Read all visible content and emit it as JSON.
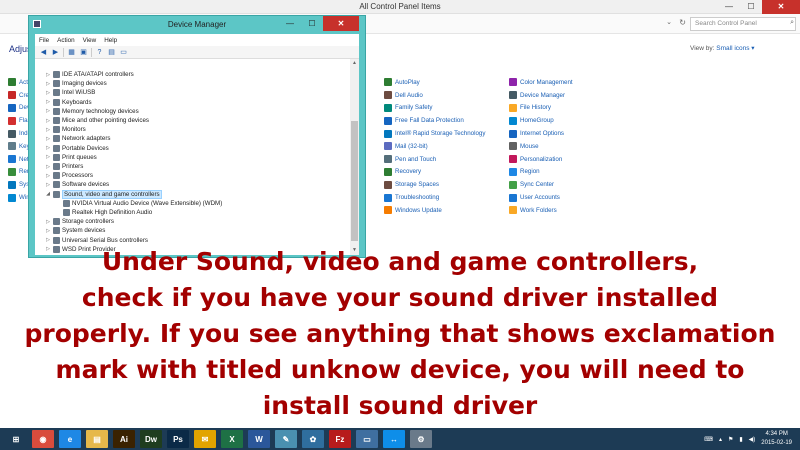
{
  "control_panel": {
    "title": "All Control Panel Items",
    "search_placeholder": "Search Control Panel",
    "adjust_heading": "Adjus",
    "view_by_label": "View by:",
    "view_by_value": "Small icons ▾",
    "left_stub": [
      {
        "label": "Acti",
        "color": "#2e7d32"
      },
      {
        "label": "Cre",
        "color": "#c62828"
      },
      {
        "label": "Dev",
        "color": "#1565c0"
      },
      {
        "label": "Flas",
        "color": "#d32f2f"
      },
      {
        "label": "Inde",
        "color": "#455a64"
      },
      {
        "label": "Key",
        "color": "#607d8b"
      },
      {
        "label": "Net",
        "color": "#1976d2"
      },
      {
        "label": "Ren",
        "color": "#388e3c"
      },
      {
        "label": "Syst",
        "color": "#0277bd"
      },
      {
        "label": "Win",
        "color": "#0288d1"
      }
    ],
    "col2": [
      {
        "label": "AutoPlay",
        "color": "#2e7d32"
      },
      {
        "label": "Dell Audio",
        "color": "#6d4c41"
      },
      {
        "label": "Family Safety",
        "color": "#00897b"
      },
      {
        "label": "Free Fall Data Protection",
        "color": "#1565c0"
      },
      {
        "label": "Intel® Rapid Storage Technology",
        "color": "#0277bd"
      },
      {
        "label": "Mail (32-bit)",
        "color": "#5c6bc0"
      },
      {
        "label": "Pen and Touch",
        "color": "#546e7a"
      },
      {
        "label": "Recovery",
        "color": "#2e7d32"
      },
      {
        "label": "Storage Spaces",
        "color": "#6d4c41"
      },
      {
        "label": "Troubleshooting",
        "color": "#1976d2"
      },
      {
        "label": "Windows Update",
        "color": "#f57c00"
      }
    ],
    "col3": [
      {
        "label": "Color Management",
        "color": "#8e24aa"
      },
      {
        "label": "Device Manager",
        "color": "#455a64"
      },
      {
        "label": "File History",
        "color": "#f9a825"
      },
      {
        "label": "HomeGroup",
        "color": "#0288d1"
      },
      {
        "label": "Internet Options",
        "color": "#1565c0"
      },
      {
        "label": "Mouse",
        "color": "#616161"
      },
      {
        "label": "Personalization",
        "color": "#c2185b"
      },
      {
        "label": "Region",
        "color": "#1e88e5"
      },
      {
        "label": "Sync Center",
        "color": "#43a047"
      },
      {
        "label": "User Accounts",
        "color": "#1976d2"
      },
      {
        "label": "Work Folders",
        "color": "#f9a825"
      }
    ]
  },
  "device_manager": {
    "title": "Device Manager",
    "menu": [
      "File",
      "Action",
      "View",
      "Help"
    ],
    "tree": [
      {
        "label": "IDE ATA/ATAPI controllers",
        "level": 1,
        "arrow": "▷"
      },
      {
        "label": "Imaging devices",
        "level": 1,
        "arrow": "▷"
      },
      {
        "label": "Intel WiUSB",
        "level": 1,
        "arrow": "▷"
      },
      {
        "label": "Keyboards",
        "level": 1,
        "arrow": "▷"
      },
      {
        "label": "Memory technology devices",
        "level": 1,
        "arrow": "▷"
      },
      {
        "label": "Mice and other pointing devices",
        "level": 1,
        "arrow": "▷"
      },
      {
        "label": "Monitors",
        "level": 1,
        "arrow": "▷"
      },
      {
        "label": "Network adapters",
        "level": 1,
        "arrow": "▷"
      },
      {
        "label": "Portable Devices",
        "level": 1,
        "arrow": "▷"
      },
      {
        "label": "Print queues",
        "level": 1,
        "arrow": "▷"
      },
      {
        "label": "Printers",
        "level": 1,
        "arrow": "▷"
      },
      {
        "label": "Processors",
        "level": 1,
        "arrow": "▷"
      },
      {
        "label": "Software devices",
        "level": 1,
        "arrow": "▷"
      },
      {
        "label": "Sound, video and game controllers",
        "level": 1,
        "arrow": "◢",
        "selected": true
      },
      {
        "label": "NVIDIA Virtual Audio Device (Wave Extensible) (WDM)",
        "level": 2,
        "arrow": ""
      },
      {
        "label": "Realtek High Definition Audio",
        "level": 2,
        "arrow": ""
      },
      {
        "label": "Storage controllers",
        "level": 1,
        "arrow": "▷"
      },
      {
        "label": "System devices",
        "level": 1,
        "arrow": "▷"
      },
      {
        "label": "Universal Serial Bus controllers",
        "level": 1,
        "arrow": "▷"
      },
      {
        "label": "WSD Print Provider",
        "level": 1,
        "arrow": "▷"
      }
    ]
  },
  "caption": {
    "lines": [
      "Under Sound, video and game controllers,",
      "check if you have your sound driver installed",
      "properly. If you see anything that shows exclamation",
      "mark with titled unknow device, you will need to",
      "install sound driver"
    ]
  },
  "taskbar": {
    "apps": [
      {
        "name": "start",
        "label": "⊞",
        "bg": "#1d3b55"
      },
      {
        "name": "chrome",
        "label": "◉",
        "bg": "#d94c3d"
      },
      {
        "name": "ie",
        "label": "e",
        "bg": "#1e88e5"
      },
      {
        "name": "explorer",
        "label": "▤",
        "bg": "#e6b84a"
      },
      {
        "name": "illustrator",
        "label": "Ai",
        "bg": "#3a2200"
      },
      {
        "name": "dreamweaver",
        "label": "Dw",
        "bg": "#1f3d1f"
      },
      {
        "name": "photoshop",
        "label": "Ps",
        "bg": "#0b2a47"
      },
      {
        "name": "outlook",
        "label": "✉",
        "bg": "#e2a400"
      },
      {
        "name": "excel",
        "label": "X",
        "bg": "#1e7145"
      },
      {
        "name": "word",
        "label": "W",
        "bg": "#2b579a"
      },
      {
        "name": "notepad",
        "label": "✎",
        "bg": "#4a90b0"
      },
      {
        "name": "paint",
        "label": "✿",
        "bg": "#2f6e9e"
      },
      {
        "name": "filezilla",
        "label": "Fz",
        "bg": "#b71c1c"
      },
      {
        "name": "remote",
        "label": "▭",
        "bg": "#3f6fa0"
      },
      {
        "name": "teamviewer",
        "label": "↔",
        "bg": "#0e8ee9"
      },
      {
        "name": "devmgr",
        "label": "⚙",
        "bg": "#6a7a8a"
      }
    ],
    "time": "4:34 PM",
    "date": "2015-02-19"
  }
}
